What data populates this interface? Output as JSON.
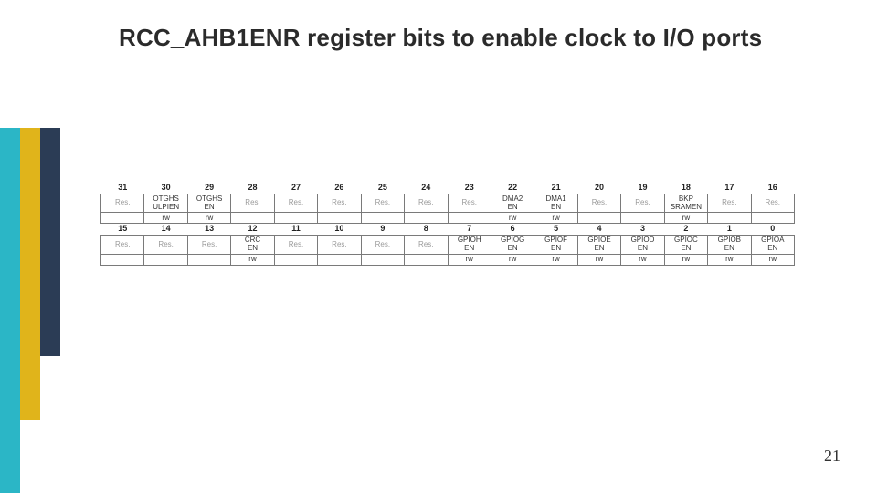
{
  "title": "RCC_AHB1ENR register bits to enable clock to I/O ports",
  "page_number": "21",
  "row_high": {
    "bits": [
      "31",
      "30",
      "29",
      "28",
      "27",
      "26",
      "25",
      "24",
      "23",
      "22",
      "21",
      "20",
      "19",
      "18",
      "17",
      "16"
    ],
    "names": [
      {
        "l1": "Res.",
        "res": true
      },
      {
        "l1": "OTGHS",
        "l2": "ULPIEN"
      },
      {
        "l1": "OTGHS",
        "l2": "EN"
      },
      {
        "l1": "Res.",
        "res": true
      },
      {
        "l1": "Res.",
        "res": true
      },
      {
        "l1": "Res.",
        "res": true
      },
      {
        "l1": "Res.",
        "res": true
      },
      {
        "l1": "Res.",
        "res": true
      },
      {
        "l1": "Res.",
        "res": true
      },
      {
        "l1": "DMA2",
        "l2": "EN"
      },
      {
        "l1": "DMA1",
        "l2": "EN"
      },
      {
        "l1": "Res.",
        "res": true
      },
      {
        "l1": "Res.",
        "res": true
      },
      {
        "l1": "BKP",
        "l2": "SRAMEN"
      },
      {
        "l1": "Res.",
        "res": true
      },
      {
        "l1": "Res.",
        "res": true
      }
    ],
    "rw": [
      "",
      "rw",
      "rw",
      "",
      "",
      "",
      "",
      "",
      "",
      "rw",
      "rw",
      "",
      "",
      "rw",
      "",
      ""
    ]
  },
  "row_low": {
    "bits": [
      "15",
      "14",
      "13",
      "12",
      "11",
      "10",
      "9",
      "8",
      "7",
      "6",
      "5",
      "4",
      "3",
      "2",
      "1",
      "0"
    ],
    "names": [
      {
        "l1": "Res.",
        "res": true
      },
      {
        "l1": "Res.",
        "res": true
      },
      {
        "l1": "Res.",
        "res": true
      },
      {
        "l1": "CRC",
        "l2": "EN"
      },
      {
        "l1": "Res.",
        "res": true
      },
      {
        "l1": "Res.",
        "res": true
      },
      {
        "l1": "Res.",
        "res": true
      },
      {
        "l1": "Res.",
        "res": true
      },
      {
        "l1": "GPIOH",
        "l2": "EN"
      },
      {
        "l1": "GPIOG",
        "l2": "EN"
      },
      {
        "l1": "GPIOF",
        "l2": "EN"
      },
      {
        "l1": "GPIOE",
        "l2": "EN"
      },
      {
        "l1": "GPIOD",
        "l2": "EN"
      },
      {
        "l1": "GPIOC",
        "l2": "EN"
      },
      {
        "l1": "GPIOB",
        "l2": "EN"
      },
      {
        "l1": "GPIOA",
        "l2": "EN"
      }
    ],
    "rw": [
      "",
      "",
      "",
      "rw",
      "",
      "",
      "",
      "",
      "rw",
      "rw",
      "rw",
      "rw",
      "rw",
      "rw",
      "rw",
      "rw"
    ]
  }
}
